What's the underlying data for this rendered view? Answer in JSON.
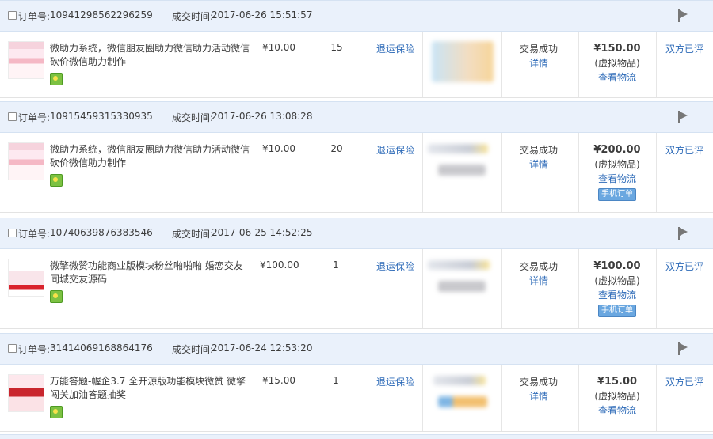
{
  "labels": {
    "order_no": "订单号:",
    "deal_time": "成交时间:",
    "refund_insurance": "退运保险",
    "details": "详情",
    "view_logistics": "查看物流",
    "virtual_goods": "(虚拟物品)",
    "both_reviewed": "双方已评",
    "mobile_order": "手机订单"
  },
  "orders": [
    {
      "order_no": "10941298562296259",
      "deal_time": "2017-06-26 15:51:57",
      "title": "微助力系统，微信朋友圈助力微信助力活动微信砍价微信助力制作",
      "price": "¥10.00",
      "qty": "15",
      "status": "交易成功",
      "total": "¥150.00",
      "mobile_order": false
    },
    {
      "order_no": "10915459315330935",
      "deal_time": "2017-06-26 13:08:28",
      "title": "微助力系统，微信朋友圈助力微信助力活动微信砍价微信助力制作",
      "price": "¥10.00",
      "qty": "20",
      "status": "交易成功",
      "total": "¥200.00",
      "mobile_order": true
    },
    {
      "order_no": "10740639876383546",
      "deal_time": "2017-06-25 14:52:25",
      "title": "微擎微赞功能商业版模块粉丝啪啪啪 婚恋交友 同城交友源码",
      "price": "¥100.00",
      "qty": "1",
      "status": "交易成功",
      "total": "¥100.00",
      "mobile_order": true
    },
    {
      "order_no": "31414069168864176",
      "deal_time": "2017-06-24 12:53:20",
      "title": "万能答题-幄企3.7 全开源版功能模块微赞 微擎 闯关加油答题抽奖",
      "price": "¥15.00",
      "qty": "1",
      "status": "交易成功",
      "total": "¥15.00",
      "mobile_order": false
    }
  ]
}
